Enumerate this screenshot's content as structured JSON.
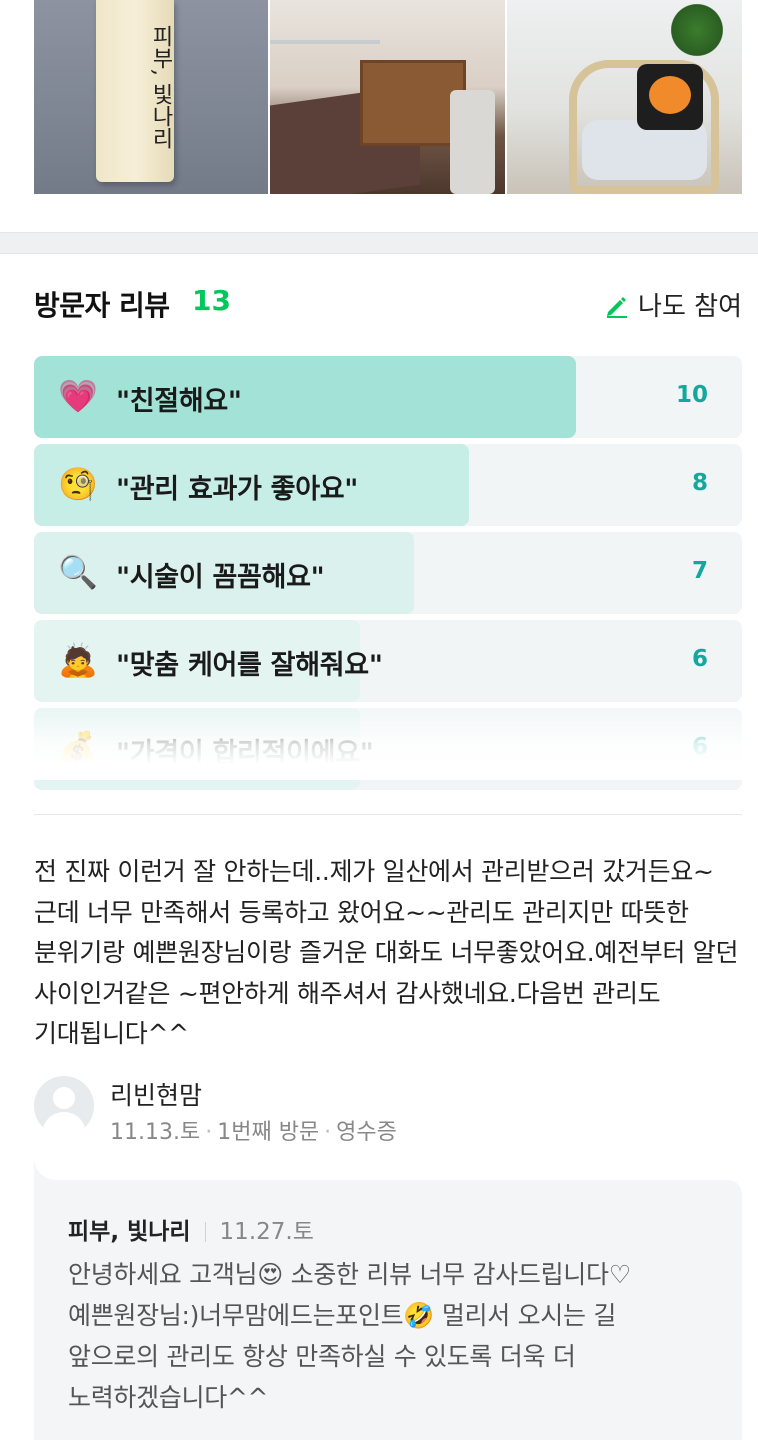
{
  "photos": [
    {
      "name": "storefront-sign-photo",
      "sign_text": "피부, 빛나리"
    },
    {
      "name": "treatment-room-photo"
    },
    {
      "name": "lounge-chair-photo"
    }
  ],
  "reviews_header": {
    "title": "방문자 리뷰",
    "count": "13",
    "join_label": "나도 참여",
    "join_icon": "pencil-icon",
    "accent_color": "#03c75a"
  },
  "keywords": [
    {
      "icon": "smiling-heart-icon",
      "glyph": "💗",
      "label": "\"친절해요\"",
      "count": "10",
      "fraction": 0.766,
      "fill_color": "#a3e2d7"
    },
    {
      "icon": "monocle-face-icon",
      "glyph": "🧐",
      "label": "\"관리 효과가 좋아요\"",
      "count": "8",
      "fraction": 0.614,
      "fill_color": "#c6ede6"
    },
    {
      "icon": "magnifier-icon",
      "glyph": "🔍",
      "label": "\"시술이 꼼꼼해요\"",
      "count": "7",
      "fraction": 0.537,
      "fill_color": "#daf1ed"
    },
    {
      "icon": "person-bowing-icon",
      "glyph": "🙇",
      "label": "\"맞춤 케어를 잘해줘요\"",
      "count": "6",
      "fraction": 0.46,
      "fill_color": "#e4f4f1"
    },
    {
      "icon": "money-icon",
      "glyph": "💰",
      "label": "\"가격이 합리적이에요\"",
      "count": "6",
      "fraction": 0.46,
      "fill_color": "#e4f4f1"
    }
  ],
  "review": {
    "text": "전 진짜 이런거 잘 안하는데..제가 일산에서 관리받으러 갔거든요~근데 너무 만족해서 등록하고 왔어요~~관리도 관리지만 따뜻한 분위기랑 예쁜원장님이랑 즐거운 대화도 너무좋았어요.예전부터 알던 사이인거같은 ~편안하게 해주셔서 감사했네요.다음번 관리도 기대됩니다^^",
    "author": "리빈현맘",
    "date": "11.13.토",
    "visit": "1번째 방문",
    "verification": "영수증"
  },
  "reply": {
    "author": "피부, 빛나리",
    "date": "11.27.토",
    "text": "안녕하세요 고객님😍 소중한 리뷰 너무 감사드립니다♡ 예쁜원장님:)너무맘에드는포인트🤣 멀리서 오시는 길 앞으로의 관리도 항상 만족하실 수 있도록 더욱 더 노력하겠습니다^^"
  }
}
